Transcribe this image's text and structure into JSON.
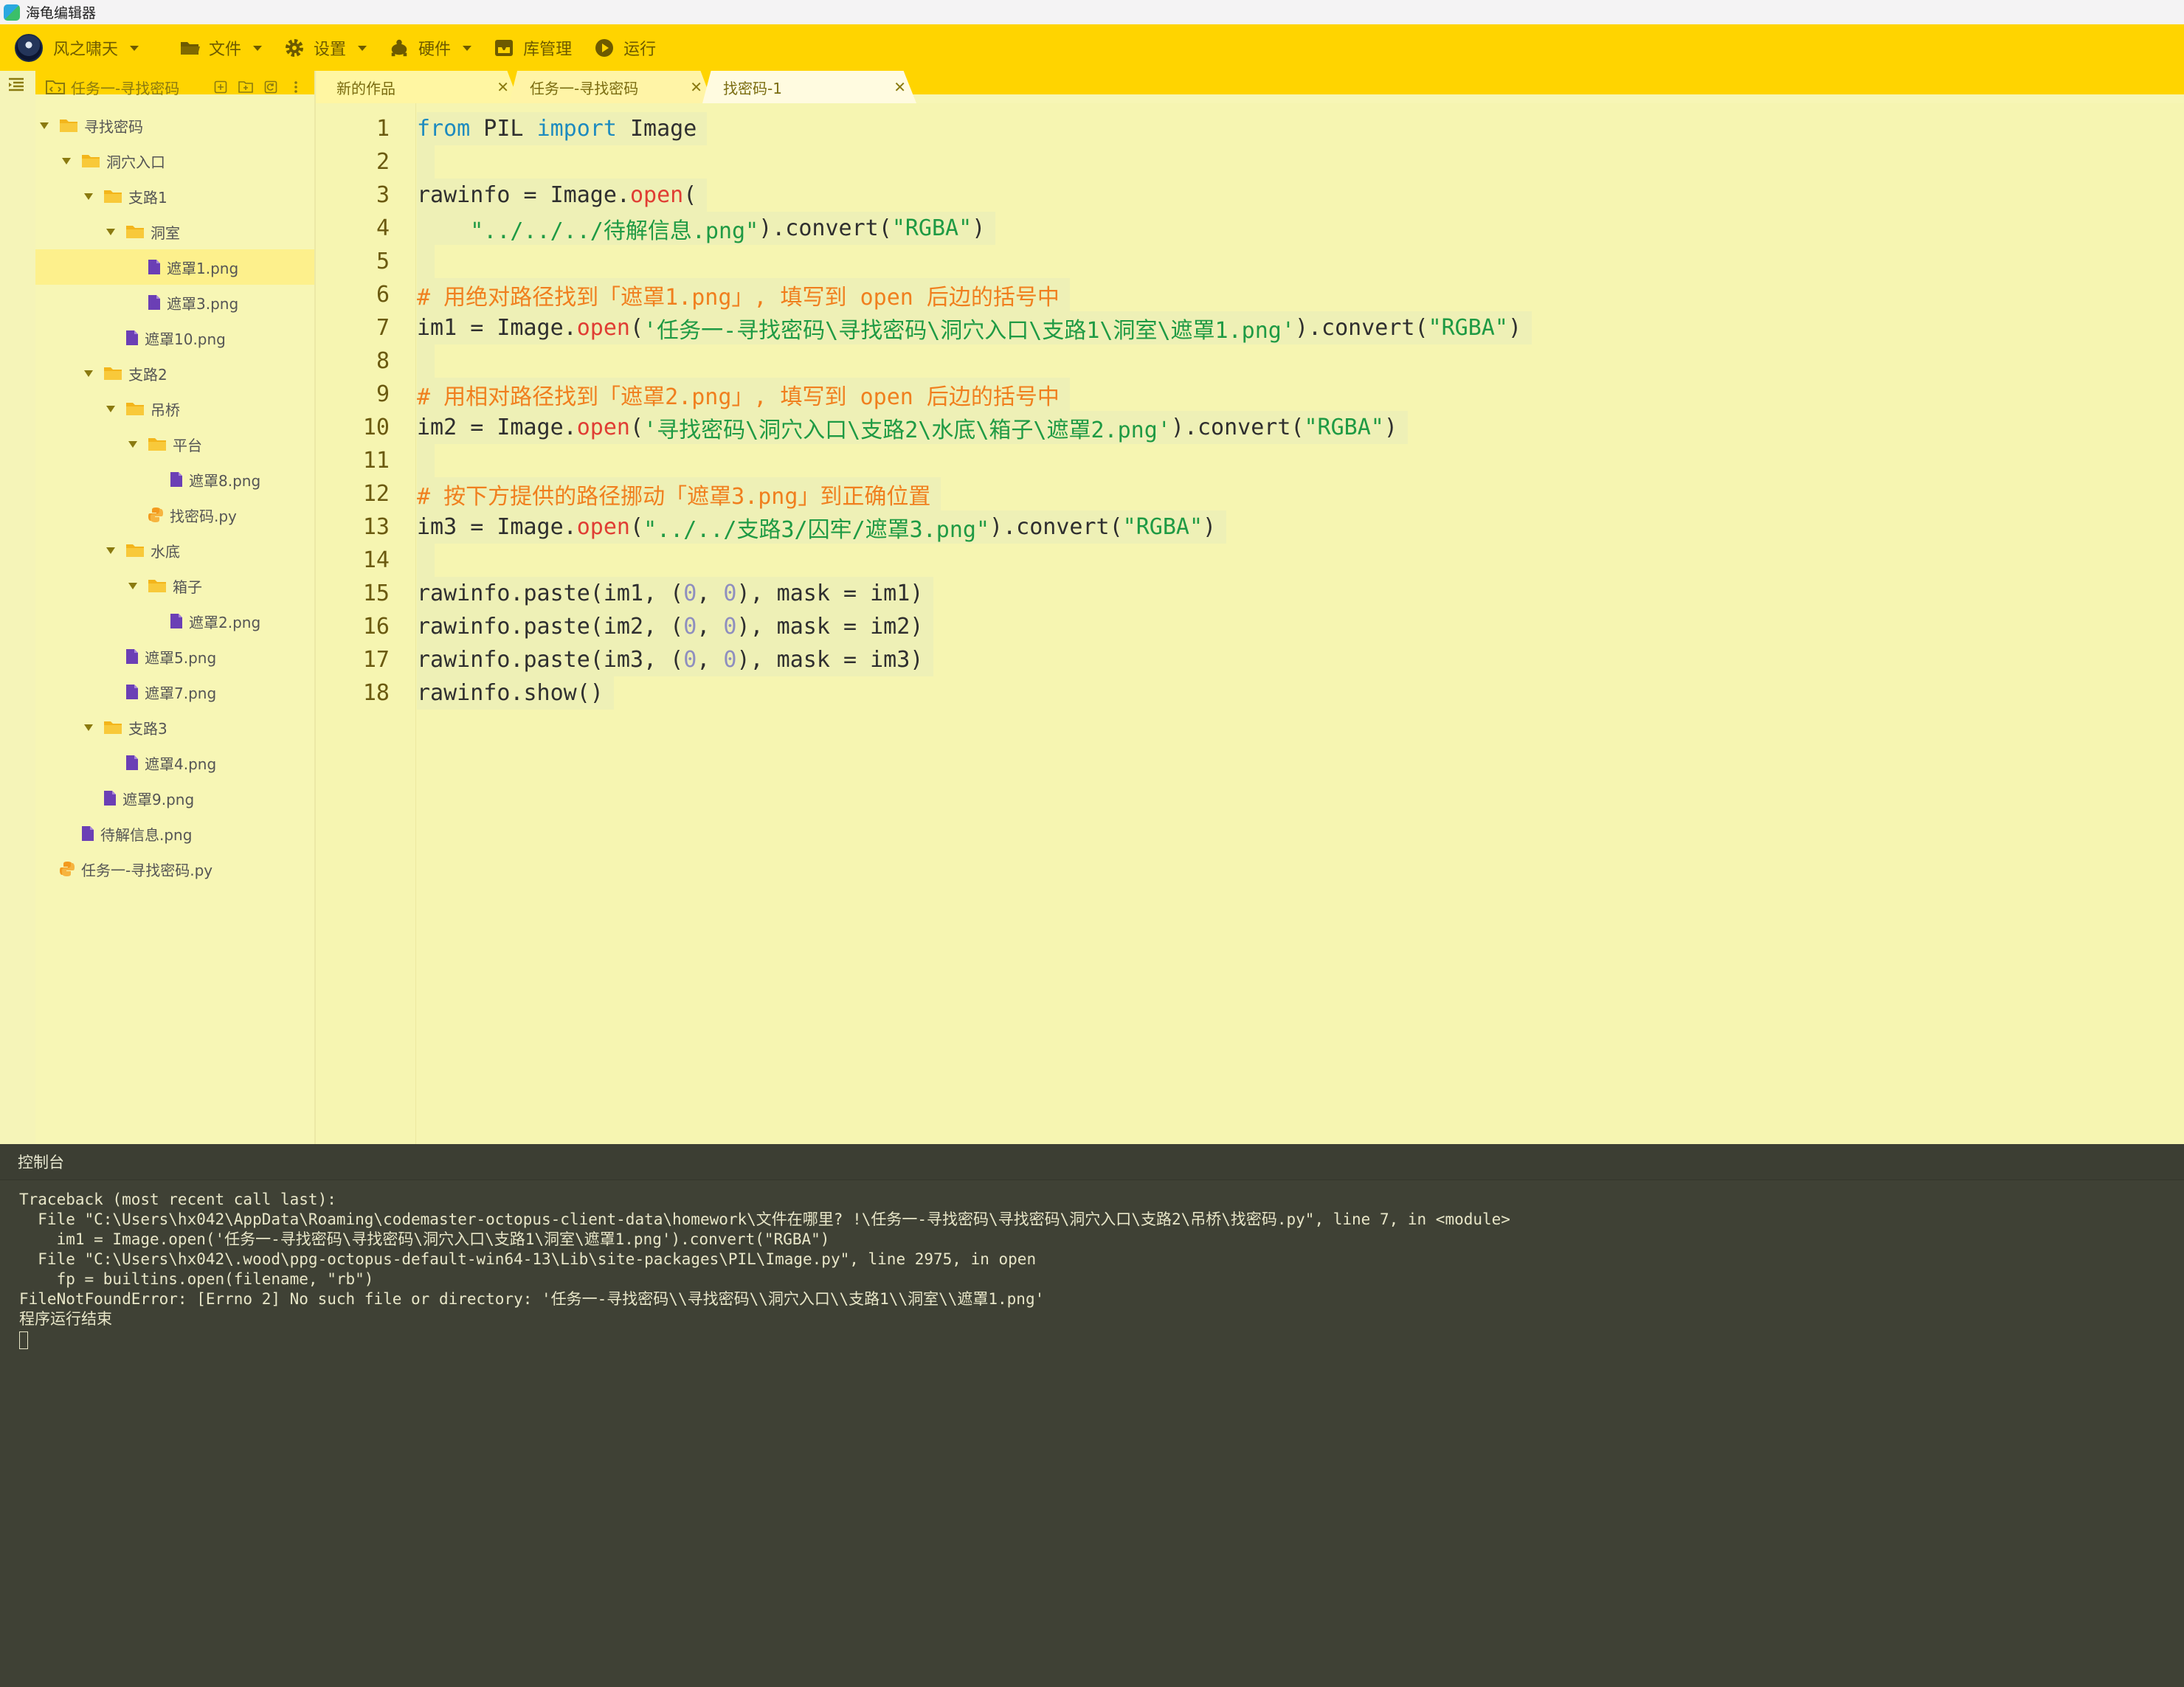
{
  "window": {
    "title": "海龟编辑器"
  },
  "menubar": {
    "user": "风之啸天",
    "file": "文件",
    "settings": "设置",
    "hardware": "硬件",
    "library": "库管理",
    "run": "运行"
  },
  "explorer": {
    "project_name": "任务一-寻找密码",
    "tree": [
      {
        "label": "寻找密码",
        "type": "folder",
        "depth": 0,
        "expanded": true
      },
      {
        "label": "洞穴入口",
        "type": "folder",
        "depth": 1,
        "expanded": true
      },
      {
        "label": "支路1",
        "type": "folder",
        "depth": 2,
        "expanded": true
      },
      {
        "label": "洞室",
        "type": "folder",
        "depth": 3,
        "expanded": true
      },
      {
        "label": "遮罩1.png",
        "type": "image",
        "depth": 4,
        "selected": true
      },
      {
        "label": "遮罩3.png",
        "type": "image",
        "depth": 4
      },
      {
        "label": "遮罩10.png",
        "type": "image",
        "depth": 3
      },
      {
        "label": "支路2",
        "type": "folder",
        "depth": 2,
        "expanded": true
      },
      {
        "label": "吊桥",
        "type": "folder",
        "depth": 3,
        "expanded": true
      },
      {
        "label": "平台",
        "type": "folder",
        "depth": 4,
        "expanded": true
      },
      {
        "label": "遮罩8.png",
        "type": "image",
        "depth": 5
      },
      {
        "label": "找密码.py",
        "type": "python",
        "depth": 4
      },
      {
        "label": "水底",
        "type": "folder",
        "depth": 3,
        "expanded": true
      },
      {
        "label": "箱子",
        "type": "folder",
        "depth": 4,
        "expanded": true
      },
      {
        "label": "遮罩2.png",
        "type": "image",
        "depth": 5
      },
      {
        "label": "遮罩5.png",
        "type": "image",
        "depth": 3
      },
      {
        "label": "遮罩7.png",
        "type": "image",
        "depth": 3
      },
      {
        "label": "支路3",
        "type": "folder",
        "depth": 2,
        "expanded": true
      },
      {
        "label": "遮罩4.png",
        "type": "image",
        "depth": 3
      },
      {
        "label": "遮罩9.png",
        "type": "image",
        "depth": 2
      },
      {
        "label": "待解信息.png",
        "type": "image",
        "depth": 1
      },
      {
        "label": "任务一-寻找密码.py",
        "type": "python",
        "depth": 0
      }
    ]
  },
  "tabs": [
    {
      "label": "新的作品",
      "active": false
    },
    {
      "label": "任务一-寻找密码",
      "active": false
    },
    {
      "label": "找密码-1",
      "active": true
    }
  ],
  "editor": {
    "lines": [
      [
        [
          "kw",
          "from"
        ],
        [
          "t",
          " PIL "
        ],
        [
          "kw",
          "import"
        ],
        [
          "t",
          " Image"
        ]
      ],
      [],
      [
        [
          "t",
          "rawinfo = Image."
        ],
        [
          "fn",
          "open"
        ],
        [
          "t",
          "("
        ]
      ],
      [
        [
          "t",
          "    "
        ],
        [
          "str",
          "\"../../../待解信息.png\""
        ],
        [
          "t",
          ").convert("
        ],
        [
          "str",
          "\"RGBA\""
        ],
        [
          "t",
          ")"
        ]
      ],
      [],
      [
        [
          "cm",
          "# 用绝对路径找到「遮罩1.png」, 填写到 open 后边的括号中"
        ]
      ],
      [
        [
          "t",
          "im1 = Image."
        ],
        [
          "fn",
          "open"
        ],
        [
          "t",
          "("
        ],
        [
          "str",
          "'任务一-寻找密码\\寻找密码\\洞穴入口\\支路1\\洞室\\遮罩1.png'"
        ],
        [
          "t",
          ").convert("
        ],
        [
          "str",
          "\"RGBA\""
        ],
        [
          "t",
          ")"
        ]
      ],
      [],
      [
        [
          "cm",
          "# 用相对路径找到「遮罩2.png」, 填写到 open 后边的括号中"
        ]
      ],
      [
        [
          "t",
          "im2 = Image."
        ],
        [
          "fn",
          "open"
        ],
        [
          "t",
          "("
        ],
        [
          "str",
          "'寻找密码\\洞穴入口\\支路2\\水底\\箱子\\遮罩2.png'"
        ],
        [
          "t",
          ").convert("
        ],
        [
          "str",
          "\"RGBA\""
        ],
        [
          "t",
          ")"
        ]
      ],
      [],
      [
        [
          "cm",
          "# 按下方提供的路径挪动「遮罩3.png」到正确位置"
        ]
      ],
      [
        [
          "t",
          "im3 = Image."
        ],
        [
          "fn",
          "open"
        ],
        [
          "t",
          "("
        ],
        [
          "str",
          "\"../../支路3/囚牢/遮罩3.png\""
        ],
        [
          "t",
          ").convert("
        ],
        [
          "str",
          "\"RGBA\""
        ],
        [
          "t",
          ")"
        ]
      ],
      [],
      [
        [
          "t",
          "rawinfo.paste(im1, ("
        ],
        [
          "num",
          "0"
        ],
        [
          "t",
          ", "
        ],
        [
          "num",
          "0"
        ],
        [
          "t",
          "), mask = im1)"
        ]
      ],
      [
        [
          "t",
          "rawinfo.paste(im2, ("
        ],
        [
          "num",
          "0"
        ],
        [
          "t",
          ", "
        ],
        [
          "num",
          "0"
        ],
        [
          "t",
          "), mask = im2)"
        ]
      ],
      [
        [
          "t",
          "rawinfo.paste(im3, ("
        ],
        [
          "num",
          "0"
        ],
        [
          "t",
          ", "
        ],
        [
          "num",
          "0"
        ],
        [
          "t",
          "), mask = im3)"
        ]
      ],
      [
        [
          "t",
          "rawinfo.show()"
        ]
      ]
    ]
  },
  "console": {
    "title": "控制台",
    "lines": [
      "Traceback (most recent call last):",
      "  File \"C:\\Users\\hx042\\AppData\\Roaming\\codemaster-octopus-client-data\\homework\\文件在哪里? !\\任务一-寻找密码\\寻找密码\\洞穴入口\\支路2\\吊桥\\找密码.py\", line 7, in <module>",
      "    im1 = Image.open('任务一-寻找密码\\寻找密码\\洞穴入口\\支路1\\洞室\\遮罩1.png').convert(\"RGBA\")",
      "  File \"C:\\Users\\hx042\\.wood\\ppg-octopus-default-win64-13\\Lib\\site-packages\\PIL\\Image.py\", line 2975, in open",
      "    fp = builtins.open(filename, \"rb\")",
      "FileNotFoundError: [Errno 2] No such file or directory: '任务一-寻找密码\\\\寻找密码\\\\洞穴入口\\\\支路1\\\\洞室\\\\遮罩1.png'",
      "程序运行结束"
    ]
  }
}
